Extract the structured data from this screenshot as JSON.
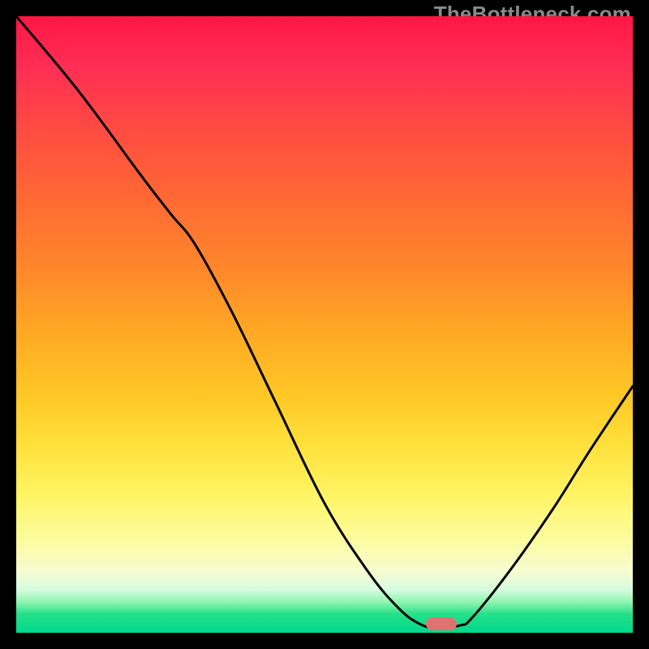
{
  "attribution": {
    "watermark_text": "TheBottleneck.com"
  },
  "marker": {
    "x_frac": 0.69,
    "y_frac": 0.985,
    "color": "#e07272"
  },
  "curve": {
    "points": [
      [
        0.0,
        0.0
      ],
      [
        0.1,
        0.12
      ],
      [
        0.2,
        0.255
      ],
      [
        0.25,
        0.32
      ],
      [
        0.29,
        0.37
      ],
      [
        0.35,
        0.48
      ],
      [
        0.42,
        0.625
      ],
      [
        0.5,
        0.79
      ],
      [
        0.57,
        0.9
      ],
      [
        0.62,
        0.96
      ],
      [
        0.653,
        0.985
      ],
      [
        0.68,
        0.992
      ],
      [
        0.72,
        0.988
      ],
      [
        0.74,
        0.975
      ],
      [
        0.8,
        0.9
      ],
      [
        0.87,
        0.8
      ],
      [
        0.93,
        0.705
      ],
      [
        1.0,
        0.6
      ]
    ]
  },
  "chart_data": {
    "type": "line",
    "title": "",
    "xlabel": "",
    "ylabel": "",
    "xlim": [
      0,
      100
    ],
    "ylim": [
      0,
      100
    ],
    "series": [
      {
        "name": "bottleneck-curve",
        "x": [
          0,
          10,
          20,
          25,
          29,
          35,
          42,
          50,
          57,
          62,
          65.3,
          68,
          72,
          74,
          80,
          87,
          93,
          100
        ],
        "values": [
          100,
          88,
          74.5,
          68,
          63,
          52,
          37.5,
          21,
          10,
          4,
          1.5,
          0.8,
          1.2,
          2.5,
          10,
          20,
          29.5,
          40
        ]
      }
    ],
    "annotations": [
      {
        "name": "optimal-marker",
        "x": 69.0,
        "y": 1.5,
        "color": "#e07272"
      }
    ],
    "background": "thermal-gradient"
  }
}
